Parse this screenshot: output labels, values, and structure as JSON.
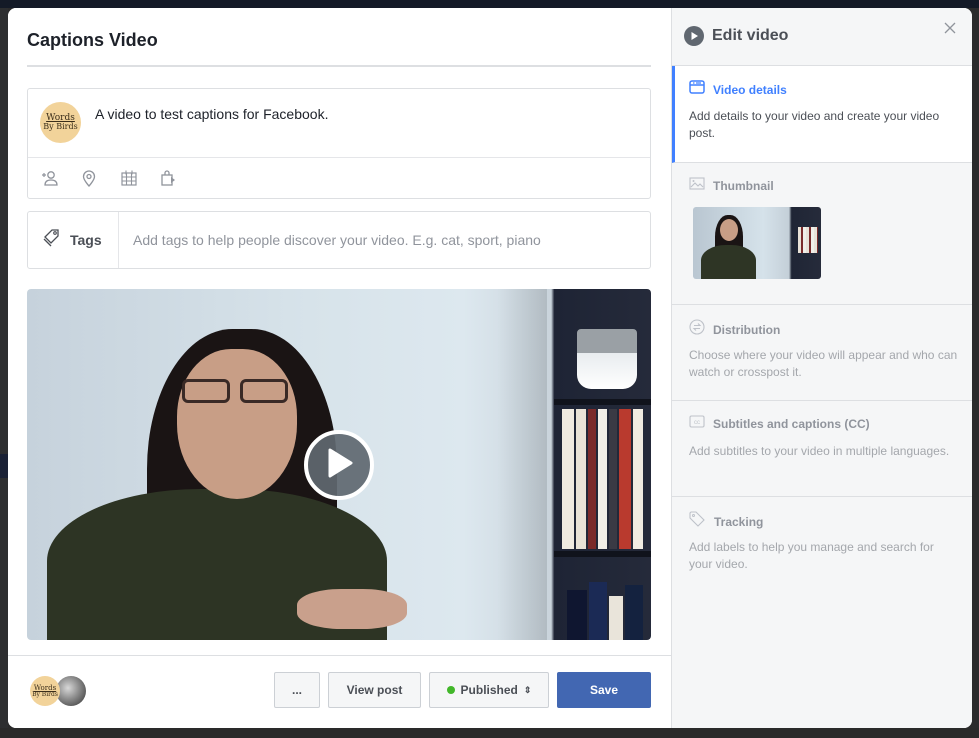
{
  "dialog": {
    "title": "Captions Video"
  },
  "composer": {
    "avatar_text_line1": "Words",
    "avatar_text_line2": "By Birds",
    "post_text": "A video to test captions for Facebook.",
    "tool_icons": [
      "tag-people-icon",
      "location-icon",
      "calendar-icon",
      "shopping-bag-icon"
    ]
  },
  "tags": {
    "label": "Tags",
    "value": "",
    "placeholder": "Add tags to help people discover your video. E.g. cat, sport, piano"
  },
  "video": {
    "play_icon": "play-icon"
  },
  "footer": {
    "more_label": "...",
    "view_post_label": "View post",
    "status_label": "Published",
    "status_color": "#42b72a",
    "save_label": "Save",
    "save_color": "#4267b2"
  },
  "side_panel": {
    "title": "Edit video",
    "close_icon": "close-icon",
    "sections": [
      {
        "id": "video-details",
        "title": "Video details",
        "description": "Add details to your video and create your video post.",
        "active": true,
        "accent": "#4080ff"
      },
      {
        "id": "thumbnail",
        "title": "Thumbnail",
        "description": ""
      },
      {
        "id": "distribution",
        "title": "Distribution",
        "description": "Choose where your video will appear and who can watch or crosspost it."
      },
      {
        "id": "subtitles",
        "title": "Subtitles and captions (CC)",
        "description": "Add subtitles to your video in multiple languages."
      },
      {
        "id": "tracking",
        "title": "Tracking",
        "description": "Add labels to help you manage and search for your video."
      }
    ]
  }
}
